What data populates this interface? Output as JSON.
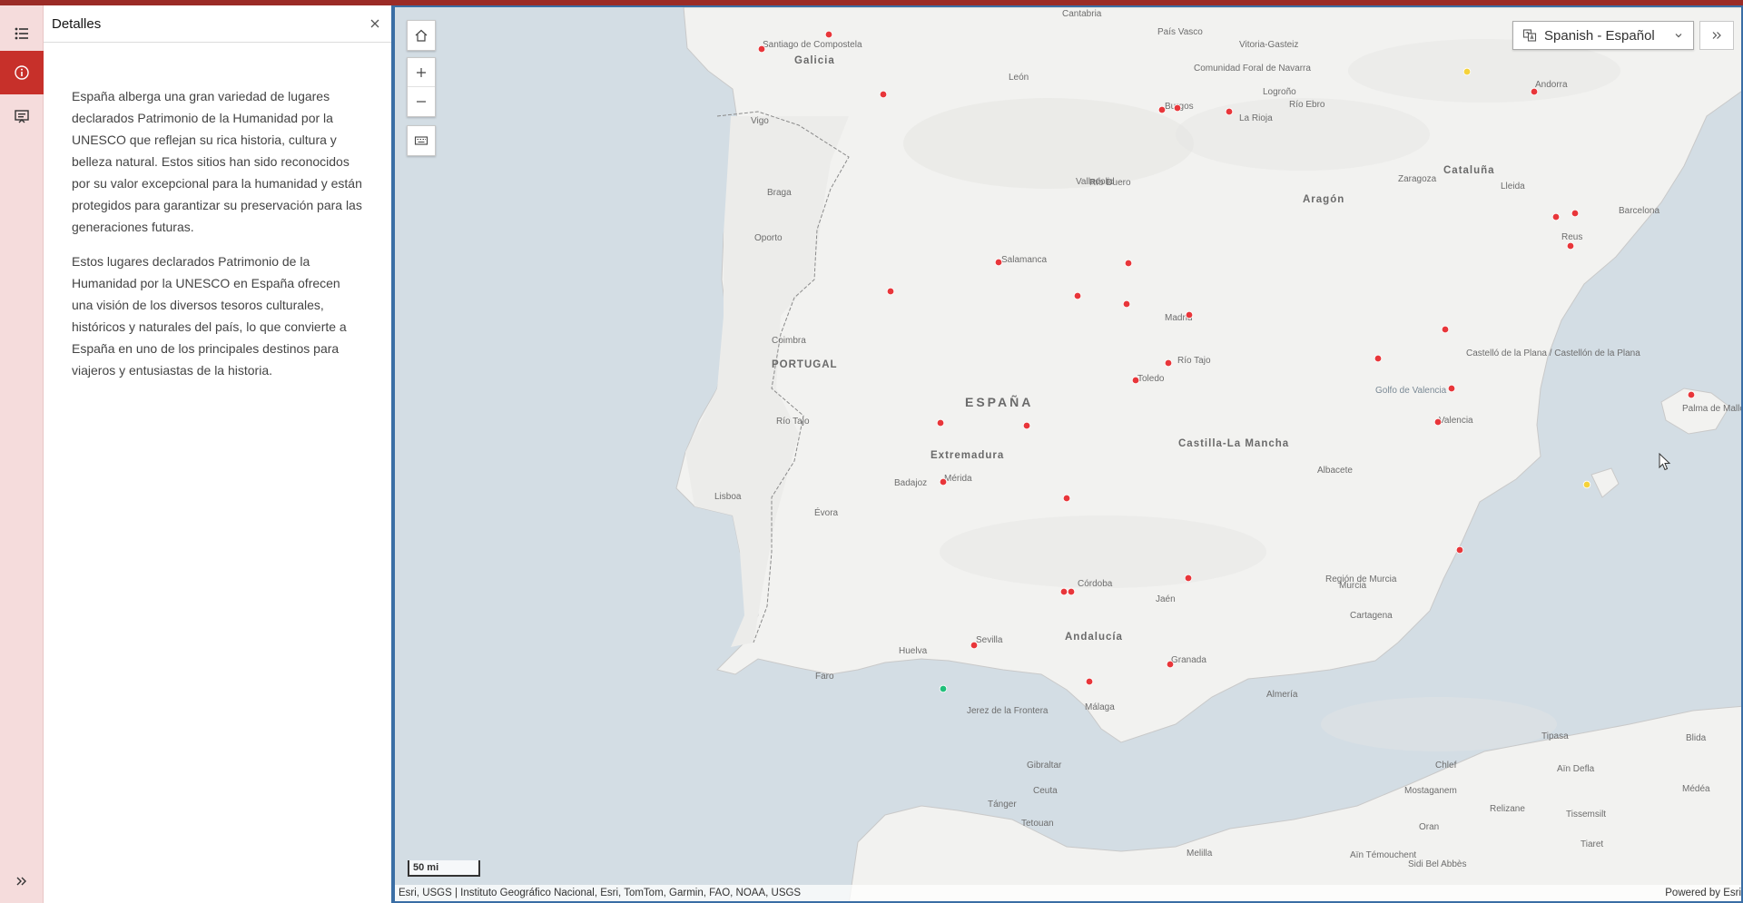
{
  "panel": {
    "title": "Detalles",
    "paragraphs": [
      "España alberga una gran variedad de lugares declarados Patrimonio de la Humanidad por la UNESCO que reflejan su rica historia, cultura y belleza natural. Estos sitios han sido reconocidos por su valor excepcional para la humanidad y están protegidos para garantizar su preservación para las generaciones futuras.",
      "Estos lugares declarados Patrimonio de la Humanidad por la UNESCO en España ofrecen una visión de los diversos tesoros culturales, históricos y naturales del país, lo que convierte a España en uno de los principales destinos para viajeros y entusiastas de la historia."
    ]
  },
  "language_selector": {
    "label": "Spanish - Español"
  },
  "scalebar": {
    "label": "50 mi"
  },
  "attribution": {
    "sources": "Esri, USGS | Instituto Geográfico Nacional, Esri, TomTom, Garmin, FAO, NOAA, USGS",
    "powered_by": "Powered by Esri"
  },
  "map_labels": {
    "country": "ESPAÑA",
    "portugal": "PORTUGAL",
    "regions": [
      "Galicia",
      "Extremadura",
      "Castilla-La Mancha",
      "Andalucía",
      "Aragón",
      "Cataluña",
      "La Rioja",
      "Comunidad Foral de Navarra",
      "País Vasco",
      "Cantabria",
      "Región de Murcia",
      "Golfo de Valencia"
    ],
    "cities": [
      "Santiago de Compostela",
      "León",
      "Burgos",
      "Vigo",
      "Braga",
      "Oporto",
      "Valladolid",
      "Salamanca",
      "Coimbra",
      "Madrid",
      "Toledo",
      "Lisboa",
      "Évora",
      "Badajoz",
      "Mérida",
      "Albacete",
      "Valencia",
      "Castelló de la Plana / Castellón de la Plana",
      "Barcelona",
      "Reus",
      "Lleida",
      "Zaragoza",
      "Logroño",
      "Vitoria-Gasteiz",
      "Andorra",
      "Córdoba",
      "Jaén",
      "Sevilla",
      "Huelva",
      "Faro",
      "Jerez de la Frontera",
      "Granada",
      "Málaga",
      "Almería",
      "Murcia",
      "Cartagena",
      "Gibraltar",
      "Ceuta",
      "Tánger",
      "Tetouan",
      "Melilla",
      "Palma de Mallorca",
      "Tipasa",
      "Blida",
      "Médéa",
      "Chlef",
      "Aïn Defla",
      "Mostaganem",
      "Relizane",
      "Oran",
      "Tissemsilt",
      "Aïn Témouchent",
      "Sidi Bel Abbès",
      "Tiaret",
      "Río Duero",
      "Río Tajo",
      "Río Ebro",
      "Río Tajo"
    ]
  },
  "colors": {
    "site_marker": "#e8363a",
    "natural_marker": "#1fbf7a",
    "mixed_marker": "#f5d23a",
    "accent": "#c7302a"
  }
}
